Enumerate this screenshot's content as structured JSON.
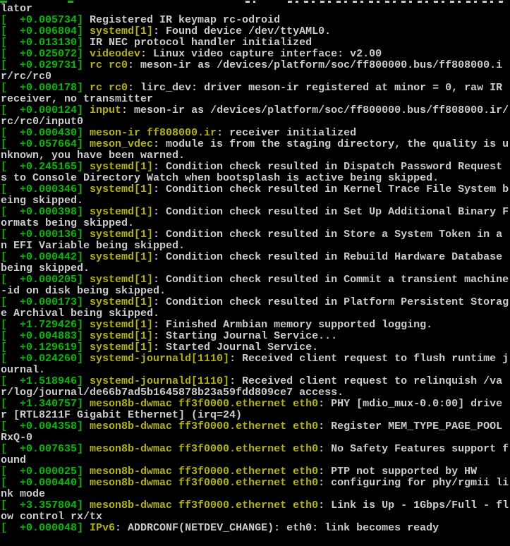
{
  "terminal": {
    "type": "kernel-boot-log-console",
    "background": "#000000",
    "colors": {
      "timestamp": "#00BB00",
      "tag": "#B3B300",
      "text": "#CBCBCB"
    },
    "format": {
      "timestamp_open": "[  ",
      "timestamp_close": "] ",
      "columns": 80
    },
    "clipped_top_line": {
      "note": "first physical line is cut off by the top edge; only bottoms of glyphs are visible, its wrapped continuation is the first readable row"
    },
    "lines": [
      {
        "time": null,
        "tag": null,
        "msg": "lator"
      },
      {
        "time": "+0.005734",
        "tag": null,
        "msg": "Registered IR keymap rc-odroid"
      },
      {
        "time": "+0.006804",
        "tag": "systemd[1]",
        "msg": ": Found device /dev/ttyAML0."
      },
      {
        "time": "+0.013130",
        "tag": null,
        "msg": "IR NEC protocol handler initialized"
      },
      {
        "time": "+0.025072",
        "tag": "videodev",
        "msg": ": Linux video capture interface: v2.00"
      },
      {
        "time": "+0.029731",
        "tag": "rc rc0",
        "msg": ": meson-ir as /devices/platform/soc/ff800000.bus/ff808000.ir/rc/rc0"
      },
      {
        "time": "+0.000178",
        "tag": "rc rc0",
        "msg": ": lirc_dev: driver meson-ir registered at minor = 0, raw IR receiver, no transmitter"
      },
      {
        "time": "+0.000124",
        "tag": "input",
        "msg": ": meson-ir as /devices/platform/soc/ff800000.bus/ff808000.ir/rc/rc0/input0"
      },
      {
        "time": "+0.000430",
        "tag": "meson-ir ff808000.ir",
        "msg": ": receiver initialized"
      },
      {
        "time": "+0.057664",
        "tag": "meson_vdec",
        "msg": ": module is from the staging directory, the quality is unknown, you have been warned."
      },
      {
        "time": "+0.245165",
        "tag": "systemd[1]",
        "msg": ": Condition check resulted in Dispatch Password Requests to Console Directory Watch when bootsplash is active being skipped."
      },
      {
        "time": "+0.000346",
        "tag": "systemd[1]",
        "msg": ": Condition check resulted in Kernel Trace File System being skipped."
      },
      {
        "time": "+0.000398",
        "tag": "systemd[1]",
        "msg": ": Condition check resulted in Set Up Additional Binary Formats being skipped."
      },
      {
        "time": "+0.000136",
        "tag": "systemd[1]",
        "msg": ": Condition check resulted in Store a System Token in an EFI Variable being skipped."
      },
      {
        "time": "+0.000442",
        "tag": "systemd[1]",
        "msg": ": Condition check resulted in Rebuild Hardware Database being skipped."
      },
      {
        "time": "+0.000205",
        "tag": "systemd[1]",
        "msg": ": Condition check resulted in Commit a transient machine-id on disk being skipped."
      },
      {
        "time": "+0.000173",
        "tag": "systemd[1]",
        "msg": ": Condition check resulted in Platform Persistent Storage Archival being skipped."
      },
      {
        "time": "+1.729426",
        "tag": "systemd[1]",
        "msg": ": Finished Armbian memory supported logging."
      },
      {
        "time": "+0.004883",
        "tag": "systemd[1]",
        "msg": ": Starting Journal Service..."
      },
      {
        "time": "+0.129619",
        "tag": "systemd[1]",
        "msg": ": Started Journal Service."
      },
      {
        "time": "+0.024260",
        "tag": "systemd-journald[1110]",
        "msg": ": Received client request to flush runtime journal."
      },
      {
        "time": "+1.518946",
        "tag": "systemd-journald[1110]",
        "msg": ": Received client request to relinquish /var/log/journal/de66b7ad5b1645878b23a59fdd809ce7 access."
      },
      {
        "time": "+1.340757",
        "tag": "meson8b-dwmac ff3f0000.ethernet eth0",
        "msg": ": PHY [mdio_mux-0.0:00] driver [RTL8211F Gigabit Ethernet] (irq=24)"
      },
      {
        "time": "+0.004358",
        "tag": "meson8b-dwmac ff3f0000.ethernet eth0",
        "msg": ": Register MEM_TYPE_PAGE_POOL RxQ-0"
      },
      {
        "time": "+0.007635",
        "tag": "meson8b-dwmac ff3f0000.ethernet eth0",
        "msg": ": No Safety Features support found"
      },
      {
        "time": "+0.000025",
        "tag": "meson8b-dwmac ff3f0000.ethernet eth0",
        "msg": ": PTP not supported by HW"
      },
      {
        "time": "+0.000440",
        "tag": "meson8b-dwmac ff3f0000.ethernet eth0",
        "msg": ": configuring for phy/rgmii link mode"
      },
      {
        "time": "+3.357804",
        "tag": "meson8b-dwmac ff3f0000.ethernet eth0",
        "msg": ": Link is Up - 1Gbps/Full - flow control rx/tx"
      },
      {
        "time": "+0.000048",
        "tag": "IPv6",
        "msg": ": ADDRCONF(NETDEV_CHANGE): eth0: link becomes ready"
      }
    ]
  }
}
